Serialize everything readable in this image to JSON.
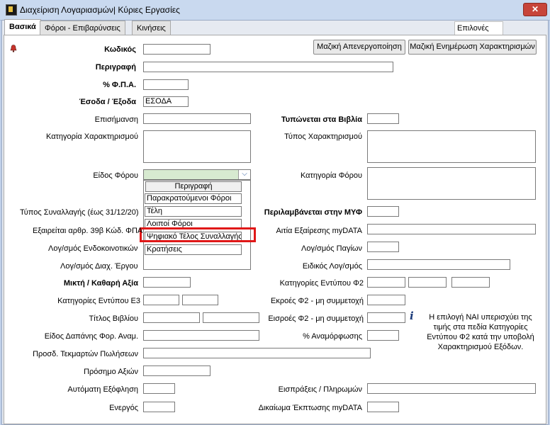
{
  "window": {
    "title": "Διαχείριση Λογαριασμών| Κύριες Εργασίες",
    "close": "✕"
  },
  "tabs": [
    "Βασικά",
    "Φόροι - Επιβαρύνσεις",
    "Κινήσεις"
  ],
  "options_label": "Επιλονές",
  "buttons": {
    "mass_deactivate": "Μαζική Απενεργοποίηση",
    "mass_update_char": "Μαζική Ενημέρωση Χαρακτηρισμών"
  },
  "labels": {
    "code": "Κωδικός",
    "description": "Περιγραφή",
    "vat": "% Φ.Π.Α.",
    "income_expense": "Έσοδα / Έξοδα",
    "notice": "Επισήμανση",
    "char_category": "Κατηγορία Χαρακτηρισμού",
    "tax_type": "Είδος Φόρου",
    "transaction_type": "Τύπος Συναλλαγής (έως 31/12/20)",
    "exempt_39b": "Εξαιρείται αρθρ. 39β Κώδ. ΦΠΑ",
    "intra_community": "Λογ/σμός Ενδοκοινοτικών",
    "work_mgmt": "Λογ/σμός Διαχ. Έργου",
    "gross_net": "Μικτή / Καθαρή Αξία",
    "e3_categories": "Κατηγορίες Εντύπου Ε3",
    "book_title": "Τίτλος Βιβλίου",
    "expense_kind": "Είδος Δαπάνης Φορ. Αναμ.",
    "sales_evidence": "Προσδ. Τεκμαρτών Πωλήσεων",
    "value_sign": "Πρόσημο Αξιών",
    "auto_settlement": "Αυτόματη Εξόφληση",
    "active": "Ενεργός",
    "printed_in_books": "Τυπώνεται στα Βιβλία",
    "char_type": "Τύπος Χαρακτηρισμού",
    "tax_category": "Κατηγορία Φόρου",
    "included_myf": "Περιλαμβάνεται στην ΜΥΦ",
    "exemption_reason": "Αιτία Εξαίρεσης myDATA",
    "fixed_assets": "Λογ/σμός Παγίων",
    "special_account": "Ειδικός Λογ/σμός",
    "f2_categories": "Κατηγορίες Εντύπου Φ2",
    "f2_outflows": "Εκροές Φ2 - μη συμμετοχή",
    "f2_inflows": "Εισροές Φ2 - μη συμμετοχή",
    "revaluation": "% Αναμόρφωσης",
    "receipts_payments": "Εισπράξεις / Πληρωμών",
    "deduction_right": "Δικαίωμα Έκπτωσης myDATA"
  },
  "values": {
    "income_expense": "ΕΣΟΔΑ"
  },
  "dropdown": {
    "header": "Περιγραφή",
    "items": [
      "Παρακρατούμενοι Φόροι",
      "Τέλη",
      "Λοιποί Φόροι",
      "Ψηφιακό Τέλος Συναλλαγής",
      "Κρατήσεις"
    ],
    "highlighted": "Ψηφιακό Τέλος Συναλλαγής"
  },
  "info_note": "Η επιλογή ΝΑΙ υπερισχύει της τιμής στα πεδία Κατηγορίες Εντύπου Φ2 κατά την υποβολή Χαρακτηρισμού Εξόδων.",
  "icons": {
    "app": "app-icon",
    "bell": "bell-icon",
    "info": "info-icon",
    "chevron": "chevron-down-icon"
  },
  "colors": {
    "highlight": "#e01818",
    "combo_bg": "#d7ead0",
    "title_bar": "#c9d9ef"
  }
}
